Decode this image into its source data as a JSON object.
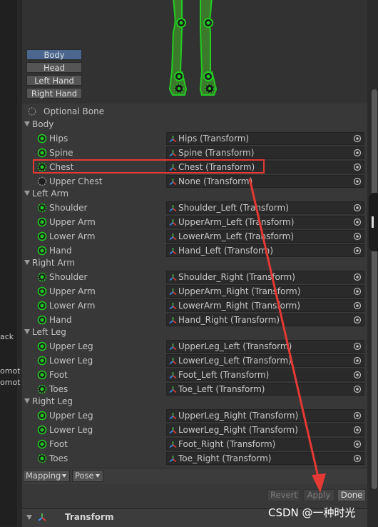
{
  "left_strip": {
    "text1": "ack",
    "text2": "omot",
    "text3": "omot"
  },
  "view_tabs": [
    {
      "label": "Body",
      "active": true
    },
    {
      "label": "Head",
      "active": false
    },
    {
      "label": "Left Hand",
      "active": false
    },
    {
      "label": "Right Hand",
      "active": false
    }
  ],
  "optional_bone_label": "Optional Bone",
  "groups": {
    "body": "Body",
    "left_arm": "Left Arm",
    "right_arm": "Right Arm",
    "left_leg": "Left Leg",
    "right_leg": "Right Leg"
  },
  "bones": [
    {
      "name": "Hips",
      "value": "Hips (Transform)",
      "optional": false
    },
    {
      "name": "Spine",
      "value": "Spine (Transform)",
      "optional": false
    },
    {
      "name": "Chest",
      "value": "Chest (Transform)",
      "optional": true
    },
    {
      "name": "Upper Chest",
      "value": "None (Transform)",
      "optional": true
    },
    {
      "name": "Shoulder",
      "value": "Shoulder_Left (Transform)",
      "optional": true
    },
    {
      "name": "Upper Arm",
      "value": "UpperArm_Left (Transform)",
      "optional": false
    },
    {
      "name": "Lower Arm",
      "value": "LowerArm_Left (Transform)",
      "optional": false
    },
    {
      "name": "Hand",
      "value": "Hand_Left (Transform)",
      "optional": false
    },
    {
      "name": "Shoulder",
      "value": "Shoulder_Right (Transform)",
      "optional": true
    },
    {
      "name": "Upper Arm",
      "value": "UpperArm_Right (Transform)",
      "optional": false
    },
    {
      "name": "Lower Arm",
      "value": "LowerArm_Right (Transform)",
      "optional": false
    },
    {
      "name": "Hand",
      "value": "Hand_Right (Transform)",
      "optional": false
    },
    {
      "name": "Upper Leg",
      "value": "UpperLeg_Left (Transform)",
      "optional": false
    },
    {
      "name": "Lower Leg",
      "value": "LowerLeg_Left (Transform)",
      "optional": false
    },
    {
      "name": "Foot",
      "value": "Foot_Left (Transform)",
      "optional": false
    },
    {
      "name": "Toes",
      "value": "Toe_Left (Transform)",
      "optional": true
    },
    {
      "name": "Upper Leg",
      "value": "UpperLeg_Right (Transform)",
      "optional": false
    },
    {
      "name": "Lower Leg",
      "value": "LowerLeg_Right (Transform)",
      "optional": false
    },
    {
      "name": "Foot",
      "value": "Foot_Right (Transform)",
      "optional": false
    },
    {
      "name": "Toes",
      "value": "Toe_Right (Transform)",
      "optional": true
    }
  ],
  "footer": {
    "mapping_label": "Mapping",
    "pose_label": "Pose"
  },
  "buttons": {
    "revert": "Revert",
    "apply": "Apply",
    "done": "Done"
  },
  "component": {
    "title": "Transform"
  },
  "watermark": "CSDN @一种时光",
  "colors": {
    "bone_green": "#22cc22",
    "annotation_red": "#e53935",
    "active_tab": "#4b678f"
  }
}
